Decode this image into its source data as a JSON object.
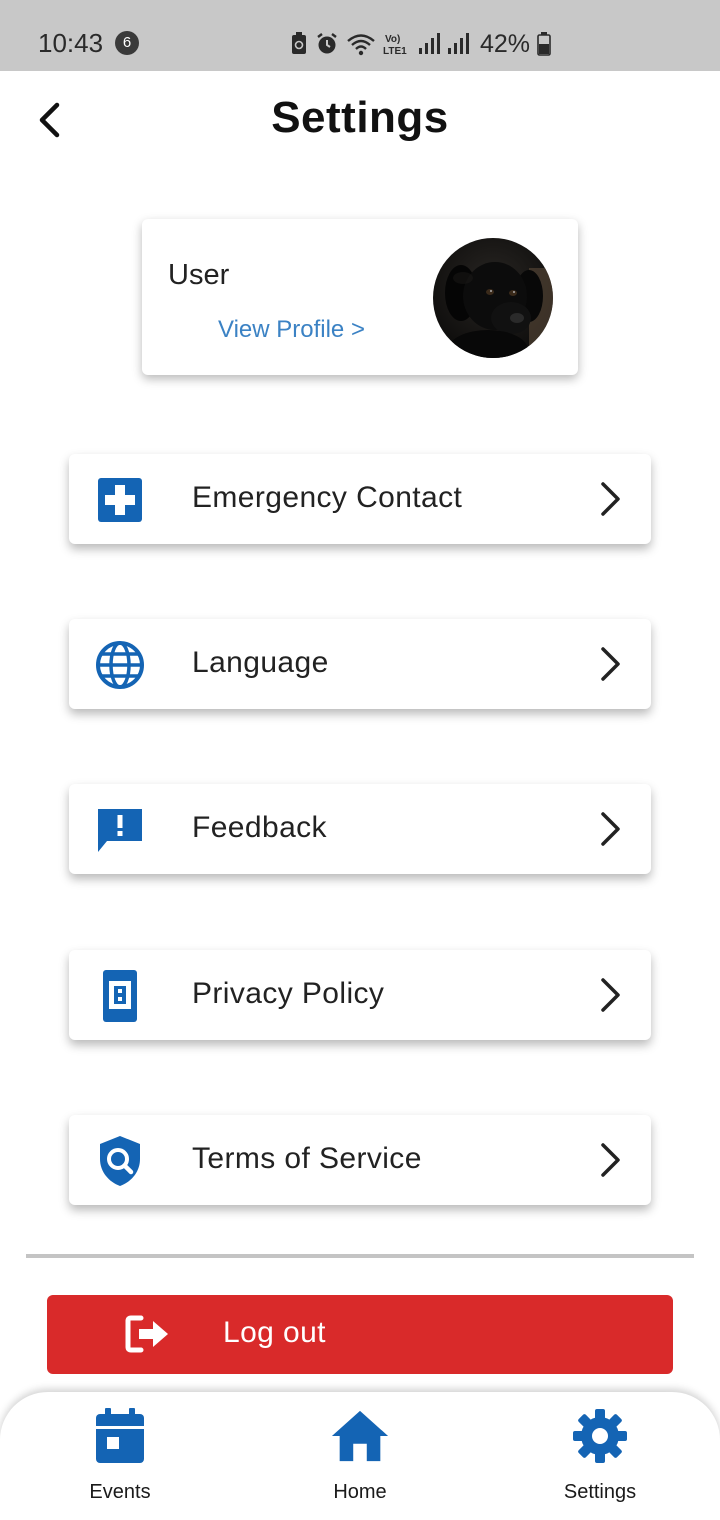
{
  "status_bar": {
    "time": "10:43",
    "notification_count": "6",
    "battery": "42%",
    "network_label": "Vo) LTE1"
  },
  "header": {
    "title": "Settings"
  },
  "profile": {
    "name": "User",
    "link": "View Profile >"
  },
  "menu": [
    {
      "label": "Emergency Contact",
      "icon": "medical-cross-icon"
    },
    {
      "label": "Language",
      "icon": "globe-icon"
    },
    {
      "label": "Feedback",
      "icon": "feedback-icon"
    },
    {
      "label": "Privacy Policy",
      "icon": "privacy-document-icon"
    },
    {
      "label": "Terms of Service",
      "icon": "shield-search-icon"
    }
  ],
  "logout": {
    "label": "Log out"
  },
  "bottom_nav": [
    {
      "label": "Events",
      "icon": "calendar-icon"
    },
    {
      "label": "Home",
      "icon": "home-icon"
    },
    {
      "label": "Settings",
      "icon": "gear-icon"
    }
  ],
  "colors": {
    "accent": "#1464b4",
    "logout": "#d92a2a",
    "link": "#3b82c4",
    "status_bar": "#c8c8c8"
  }
}
